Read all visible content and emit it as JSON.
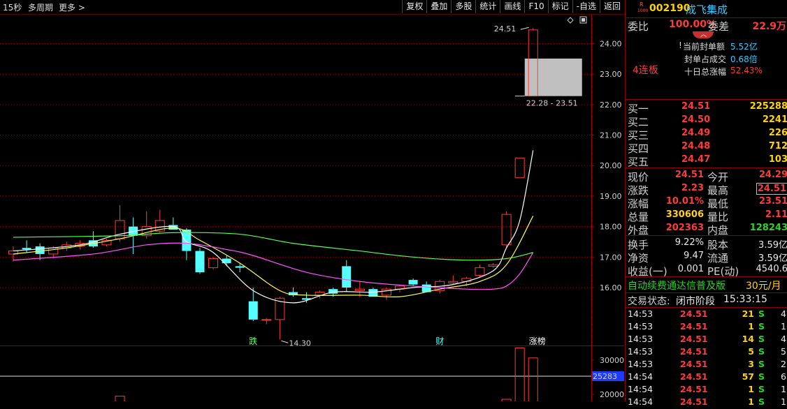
{
  "toolbar": {
    "period": "15秒",
    "multi_period": "多周期",
    "more": "更多",
    "buttons": [
      "复权",
      "叠加",
      "多股",
      "统计",
      "画线",
      "F10",
      "标记",
      "-自选",
      "返回"
    ]
  },
  "stock": {
    "code": "002190",
    "name": "成飞集成",
    "badge_top": "R",
    "badge_bottom": "1000"
  },
  "quote": {
    "wei_bi_label": "委比",
    "wei_bi": "100.00%",
    "wei_cha_label": "委差",
    "wei_cha": "22.9万",
    "streak": "4连板",
    "seal_amount_label": "当前封单额",
    "seal_amount": "5.52亿",
    "seal_ratio_label": "封单占成交",
    "seal_ratio": "0.68倍",
    "ten_day_label": "十日总涨幅",
    "ten_day": "52.43%"
  },
  "bids": [
    {
      "label": "买一",
      "price": "24.51",
      "vol": "225288"
    },
    {
      "label": "买二",
      "price": "24.50",
      "vol": "2241"
    },
    {
      "label": "买三",
      "price": "24.49",
      "vol": "226"
    },
    {
      "label": "买四",
      "price": "24.48",
      "vol": "712"
    },
    {
      "label": "买五",
      "price": "24.47",
      "vol": "103"
    }
  ],
  "stats": [
    {
      "l1": "现价",
      "v1": "24.51",
      "l2": "今开",
      "v2": "24.29"
    },
    {
      "l1": "涨跌",
      "v1": "2.23",
      "l2": "最高",
      "v2": "24.51"
    },
    {
      "l1": "涨幅",
      "v1": "10.01%",
      "l2": "最低",
      "v2": "23.51"
    },
    {
      "l1": "总量",
      "v1": "330606",
      "l2": "量比",
      "v2": "2.11"
    },
    {
      "l1": "外盘",
      "v1": "202363",
      "l2": "内盘",
      "v2": "128243"
    }
  ],
  "fund": [
    {
      "l1": "换手",
      "v1": "9.22%",
      "l2": "股本",
      "v2": "3.59亿"
    },
    {
      "l1": "净资",
      "v1": "9.47",
      "l2": "流通",
      "v2": "3.59亿"
    },
    {
      "l1": "收益(一)",
      "v1": "0.001",
      "l2": "PE(动)",
      "v2": "4540.6"
    }
  ],
  "ad": {
    "text": "自动续费通达信普及版",
    "price": "30元/月"
  },
  "trade_status": {
    "label": "交易状态:",
    "value": "闭市阶段",
    "time": "15:33:15"
  },
  "ticks": [
    {
      "t": "14:53",
      "p": "24.51",
      "v": "21",
      "s": "S",
      "n": "4"
    },
    {
      "t": "14:53",
      "p": "24.51",
      "v": "1",
      "s": "S",
      "n": "1"
    },
    {
      "t": "14:53",
      "p": "24.51",
      "v": "14",
      "s": "S",
      "n": "4"
    },
    {
      "t": "14:53",
      "p": "24.51",
      "v": "5",
      "s": "S",
      "n": "5"
    },
    {
      "t": "14:53",
      "p": "24.51",
      "v": "3",
      "s": "S",
      "n": "2"
    },
    {
      "t": "14:54",
      "p": "24.51",
      "v": "57",
      "s": "S",
      "n": "6"
    },
    {
      "t": "14:54",
      "p": "24.51",
      "v": "1",
      "s": "S",
      "n": "1"
    },
    {
      "t": "14:54",
      "p": "24.51",
      "v": "1",
      "s": "S",
      "n": "1"
    }
  ],
  "chart_data": {
    "type": "candlestick",
    "ylim": [
      14.1,
      24.95
    ],
    "y_ticks": [
      16,
      17,
      18,
      19,
      20,
      21,
      22,
      23,
      24
    ],
    "y_tick_labels": [
      "16.00",
      "17.00",
      "18.00",
      "19.00",
      "20.00",
      "21.00",
      "22.00",
      "23.00",
      "24.00"
    ],
    "colors": {
      "up": "#ff3a3a",
      "down": "#54ffff",
      "ma1": "#ffffff",
      "ma2": "#ffff54",
      "ma3": "#ff54ff",
      "ma4": "#54ff54"
    },
    "candles": [
      {
        "o": 17.1,
        "h": 17.35,
        "l": 16.85,
        "c": 17.2
      },
      {
        "o": 17.3,
        "h": 17.55,
        "l": 17.15,
        "c": 17.25
      },
      {
        "o": 17.35,
        "h": 17.45,
        "l": 16.9,
        "c": 17.1
      },
      {
        "o": 17.1,
        "h": 17.35,
        "l": 16.95,
        "c": 17.3
      },
      {
        "o": 17.3,
        "h": 17.5,
        "l": 17.2,
        "c": 17.4
      },
      {
        "o": 17.35,
        "h": 17.55,
        "l": 17.25,
        "c": 17.45
      },
      {
        "o": 17.55,
        "h": 17.85,
        "l": 17.3,
        "c": 17.35
      },
      {
        "o": 17.4,
        "h": 17.6,
        "l": 17.35,
        "c": 17.55
      },
      {
        "o": 17.6,
        "h": 18.7,
        "l": 17.5,
        "c": 18.2
      },
      {
        "o": 18.0,
        "h": 18.3,
        "l": 17.1,
        "c": 17.7
      },
      {
        "o": 17.7,
        "h": 18.5,
        "l": 17.6,
        "c": 18.0
      },
      {
        "o": 17.85,
        "h": 18.55,
        "l": 17.8,
        "c": 18.2
      },
      {
        "o": 18.05,
        "h": 18.3,
        "l": 17.9,
        "c": 17.9
      },
      {
        "o": 17.9,
        "h": 17.95,
        "l": 16.9,
        "c": 17.2
      },
      {
        "o": 17.2,
        "h": 17.3,
        "l": 16.45,
        "c": 16.5
      },
      {
        "o": 16.65,
        "h": 17.0,
        "l": 16.6,
        "c": 16.95
      },
      {
        "o": 16.95,
        "h": 17.05,
        "l": 16.7,
        "c": 16.8
      },
      {
        "o": 16.7,
        "h": 16.8,
        "l": 16.5,
        "c": 16.65
      },
      {
        "o": 15.55,
        "h": 16.0,
        "l": 14.9,
        "c": 14.95
      },
      {
        "o": 14.95,
        "h": 15.0,
        "l": 14.8,
        "c": 14.95
      },
      {
        "o": 14.95,
        "h": 15.7,
        "l": 14.3,
        "c": 15.65
      },
      {
        "o": 15.85,
        "h": 16.0,
        "l": 15.7,
        "c": 15.75
      },
      {
        "o": 15.65,
        "h": 15.85,
        "l": 15.5,
        "c": 15.6
      },
      {
        "o": 15.75,
        "h": 15.9,
        "l": 15.65,
        "c": 15.85
      },
      {
        "o": 15.95,
        "h": 16.0,
        "l": 15.7,
        "c": 15.8
      },
      {
        "o": 16.7,
        "h": 16.9,
        "l": 15.85,
        "c": 16.0
      },
      {
        "o": 15.9,
        "h": 16.2,
        "l": 15.7,
        "c": 15.95
      },
      {
        "o": 15.95,
        "h": 16.0,
        "l": 15.7,
        "c": 15.7
      },
      {
        "o": 15.75,
        "h": 16.0,
        "l": 15.6,
        "c": 15.95
      },
      {
        "o": 15.95,
        "h": 16.1,
        "l": 15.85,
        "c": 16.05
      },
      {
        "o": 16.25,
        "h": 16.3,
        "l": 16.05,
        "c": 16.1
      },
      {
        "o": 16.1,
        "h": 16.2,
        "l": 15.85,
        "c": 15.85
      },
      {
        "o": 15.9,
        "h": 16.25,
        "l": 15.8,
        "c": 16.2
      },
      {
        "o": 16.15,
        "h": 16.4,
        "l": 16.1,
        "c": 16.2
      },
      {
        "o": 16.2,
        "h": 16.35,
        "l": 16.05,
        "c": 16.3
      },
      {
        "o": 16.4,
        "h": 16.75,
        "l": 16.35,
        "c": 16.65
      },
      {
        "o": 16.7,
        "h": 16.8,
        "l": 16.65,
        "c": 16.75
      },
      {
        "o": 17.4,
        "h": 18.5,
        "l": 17.3,
        "c": 18.4
      },
      {
        "o": 19.6,
        "h": 20.25,
        "l": 19.6,
        "c": 20.25
      },
      {
        "o": 22.28,
        "h": 24.51,
        "l": 22.28,
        "c": 24.45
      }
    ],
    "ma": [
      {
        "name": "ma1",
        "points": [
          [
            0,
            17.2
          ],
          [
            5,
            17.4
          ],
          [
            8,
            17.75
          ],
          [
            12,
            18.0
          ],
          [
            13,
            17.5
          ],
          [
            15,
            17.15
          ],
          [
            18,
            15.9
          ],
          [
            21,
            15.5
          ],
          [
            24,
            15.85
          ],
          [
            27,
            15.85
          ],
          [
            30,
            16.0
          ],
          [
            33,
            16.1
          ],
          [
            36,
            16.55
          ],
          [
            37,
            17.3
          ],
          [
            38,
            18.2
          ],
          [
            39,
            20.5
          ]
        ]
      },
      {
        "name": "ma2",
        "points": [
          [
            0,
            17.1
          ],
          [
            4,
            17.3
          ],
          [
            8,
            17.6
          ],
          [
            12,
            17.95
          ],
          [
            14,
            17.55
          ],
          [
            17,
            16.8
          ],
          [
            20,
            15.9
          ],
          [
            22,
            15.75
          ],
          [
            26,
            15.75
          ],
          [
            29,
            15.7
          ],
          [
            32,
            15.95
          ],
          [
            35,
            16.2
          ],
          [
            37,
            16.75
          ],
          [
            39,
            18.35
          ]
        ]
      },
      {
        "name": "ma3",
        "points": [
          [
            0,
            16.9
          ],
          [
            6,
            17.1
          ],
          [
            10,
            17.4
          ],
          [
            13,
            17.45
          ],
          [
            16,
            17.25
          ],
          [
            18,
            17.05
          ],
          [
            22,
            16.5
          ],
          [
            26,
            16.2
          ],
          [
            30,
            16.05
          ],
          [
            34,
            15.95
          ],
          [
            36,
            15.95
          ],
          [
            37,
            16.05
          ],
          [
            38,
            16.45
          ],
          [
            39,
            17.15
          ]
        ]
      },
      {
        "name": "ma4",
        "points": [
          [
            0,
            17.65
          ],
          [
            8,
            17.7
          ],
          [
            12,
            17.8
          ],
          [
            17,
            17.75
          ],
          [
            21,
            17.45
          ],
          [
            26,
            17.2
          ],
          [
            30,
            17.0
          ],
          [
            34,
            16.9
          ],
          [
            37,
            16.95
          ],
          [
            39,
            17.15
          ]
        ]
      }
    ],
    "annotations": {
      "high_label": "24.51",
      "low_label": "14.30",
      "range_label": "22.28 - 23.51",
      "markers": [
        {
          "text": "跌",
          "index": 18,
          "color": "#54ff54"
        },
        {
          "text": "财",
          "index": 32,
          "color": "#54ffff"
        },
        {
          "text": "涨榜",
          "index": 39,
          "color": "#ffffff"
        }
      ]
    },
    "volume": {
      "y_ticks": [
        30000,
        20000
      ],
      "y_tick_labels": [
        "30000",
        "20000"
      ],
      "current_label": "25283",
      "ylim": [
        18000,
        34000
      ],
      "bars": [
        {
          "index": 8,
          "value": 19500,
          "dir": "up"
        },
        {
          "index": 37,
          "value": 18600,
          "dir": "up"
        },
        {
          "index": 38,
          "value": 33500,
          "dir": "up"
        },
        {
          "index": 39,
          "value": 30600,
          "dir": "up"
        }
      ]
    }
  }
}
